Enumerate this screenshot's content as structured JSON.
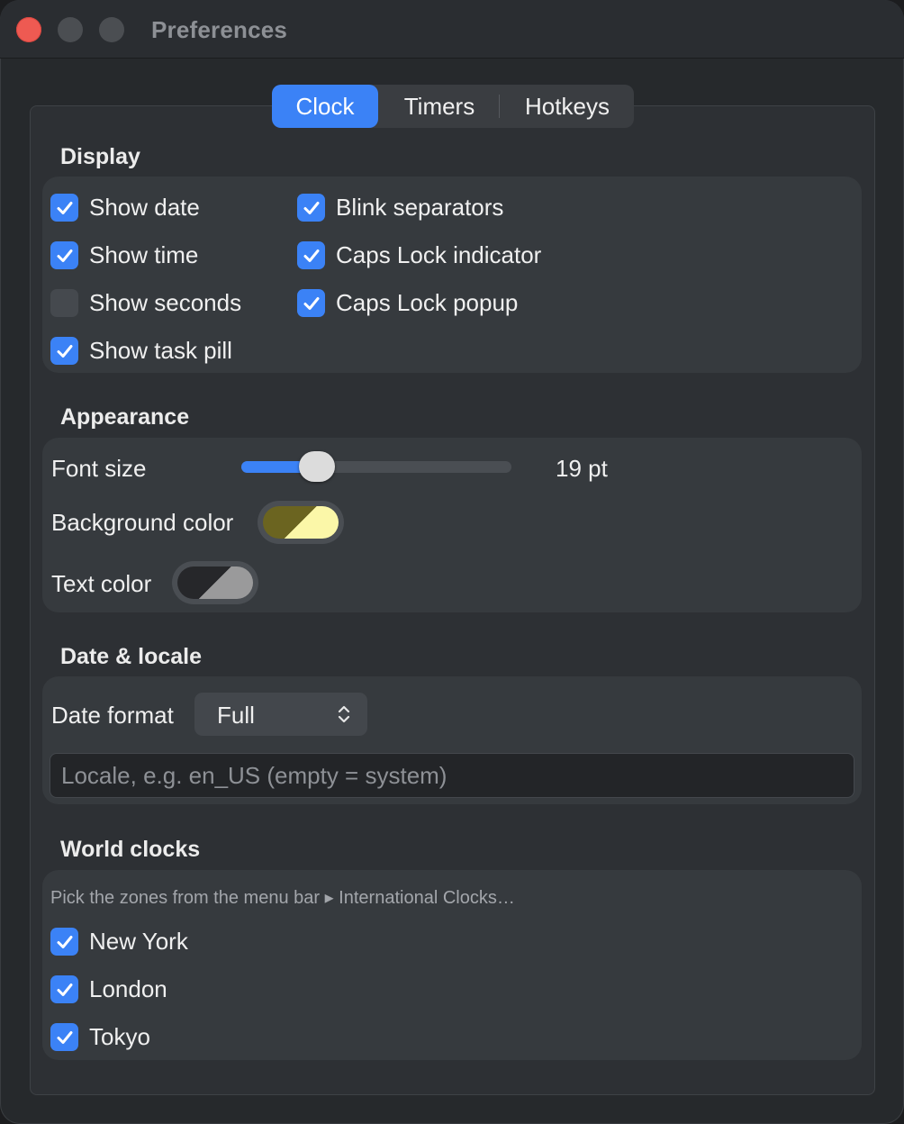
{
  "window": {
    "title": "Preferences"
  },
  "tabs": [
    {
      "label": "Clock",
      "selected": true
    },
    {
      "label": "Timers",
      "selected": false
    },
    {
      "label": "Hotkeys",
      "selected": false
    }
  ],
  "display": {
    "title": "Display",
    "left": [
      {
        "label": "Show date",
        "checked": true
      },
      {
        "label": "Show time",
        "checked": true
      },
      {
        "label": "Show seconds",
        "checked": false
      },
      {
        "label": "Show task pill",
        "checked": true
      }
    ],
    "right": [
      {
        "label": "Blink separators",
        "checked": true
      },
      {
        "label": "Caps Lock indicator",
        "checked": true
      },
      {
        "label": "Caps Lock popup",
        "checked": true
      }
    ]
  },
  "appearance": {
    "title": "Appearance",
    "font_size_label": "Font size",
    "font_size_value": "19 pt",
    "font_size_slider_fraction": 0.28,
    "background_color_label": "Background color",
    "background_color": {
      "dark": "#6b6420",
      "light": "#fbf7a8"
    },
    "text_color_label": "Text color",
    "text_color": {
      "dark": "#26272a",
      "light": "#9a9a9b"
    }
  },
  "date_locale": {
    "title": "Date & locale",
    "date_format_label": "Date format",
    "date_format_value": "Full",
    "locale_placeholder": "Locale, e.g. en_US (empty = system)",
    "locale_value": ""
  },
  "world_clocks": {
    "title": "World clocks",
    "hint": "Pick the zones from the menu bar ▸ International Clocks…",
    "items": [
      {
        "label": "New York",
        "checked": true
      },
      {
        "label": "London",
        "checked": true
      },
      {
        "label": "Tokyo",
        "checked": true
      }
    ]
  },
  "colors": {
    "accent": "#3b82f6",
    "close_button": "#ee5a52"
  }
}
